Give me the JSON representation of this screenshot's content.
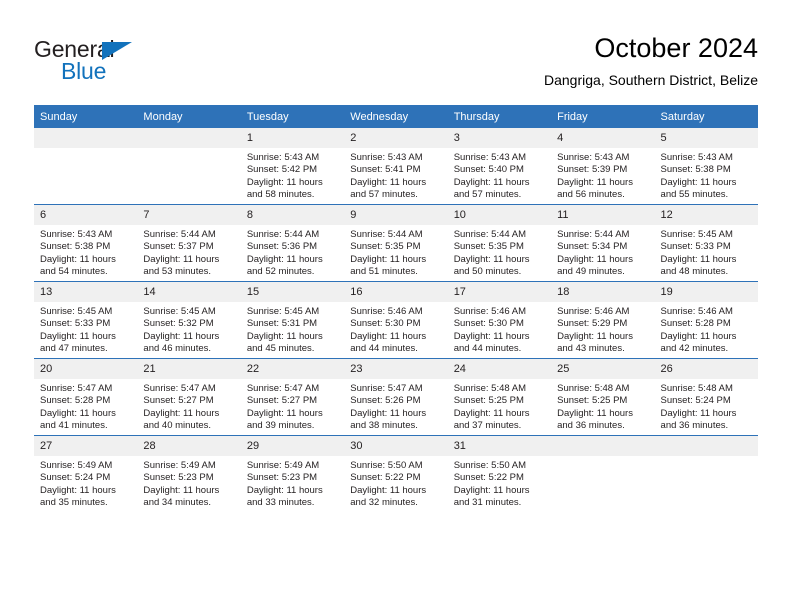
{
  "brand": {
    "name_part1": "General",
    "name_part2": "Blue",
    "accent_color": "#1272bc"
  },
  "header": {
    "title": "October 2024",
    "subtitle": "Dangriga, Southern District, Belize"
  },
  "theme": {
    "header_blue": "#2e72b8",
    "daynum_gray": "#f0f0f0"
  },
  "weekday_headers": [
    "Sunday",
    "Monday",
    "Tuesday",
    "Wednesday",
    "Thursday",
    "Friday",
    "Saturday"
  ],
  "labels": {
    "sunrise_prefix": "Sunrise:",
    "sunset_prefix": "Sunset:",
    "daylight_prefix": "Daylight:"
  },
  "weeks": [
    [
      {
        "day": "",
        "sunrise": "",
        "sunset": "",
        "daylight_line1": "",
        "daylight_line2": ""
      },
      {
        "day": "",
        "sunrise": "",
        "sunset": "",
        "daylight_line1": "",
        "daylight_line2": ""
      },
      {
        "day": "1",
        "sunrise": "Sunrise: 5:43 AM",
        "sunset": "Sunset: 5:42 PM",
        "daylight_line1": "Daylight: 11 hours",
        "daylight_line2": "and 58 minutes."
      },
      {
        "day": "2",
        "sunrise": "Sunrise: 5:43 AM",
        "sunset": "Sunset: 5:41 PM",
        "daylight_line1": "Daylight: 11 hours",
        "daylight_line2": "and 57 minutes."
      },
      {
        "day": "3",
        "sunrise": "Sunrise: 5:43 AM",
        "sunset": "Sunset: 5:40 PM",
        "daylight_line1": "Daylight: 11 hours",
        "daylight_line2": "and 57 minutes."
      },
      {
        "day": "4",
        "sunrise": "Sunrise: 5:43 AM",
        "sunset": "Sunset: 5:39 PM",
        "daylight_line1": "Daylight: 11 hours",
        "daylight_line2": "and 56 minutes."
      },
      {
        "day": "5",
        "sunrise": "Sunrise: 5:43 AM",
        "sunset": "Sunset: 5:38 PM",
        "daylight_line1": "Daylight: 11 hours",
        "daylight_line2": "and 55 minutes."
      }
    ],
    [
      {
        "day": "6",
        "sunrise": "Sunrise: 5:43 AM",
        "sunset": "Sunset: 5:38 PM",
        "daylight_line1": "Daylight: 11 hours",
        "daylight_line2": "and 54 minutes."
      },
      {
        "day": "7",
        "sunrise": "Sunrise: 5:44 AM",
        "sunset": "Sunset: 5:37 PM",
        "daylight_line1": "Daylight: 11 hours",
        "daylight_line2": "and 53 minutes."
      },
      {
        "day": "8",
        "sunrise": "Sunrise: 5:44 AM",
        "sunset": "Sunset: 5:36 PM",
        "daylight_line1": "Daylight: 11 hours",
        "daylight_line2": "and 52 minutes."
      },
      {
        "day": "9",
        "sunrise": "Sunrise: 5:44 AM",
        "sunset": "Sunset: 5:35 PM",
        "daylight_line1": "Daylight: 11 hours",
        "daylight_line2": "and 51 minutes."
      },
      {
        "day": "10",
        "sunrise": "Sunrise: 5:44 AM",
        "sunset": "Sunset: 5:35 PM",
        "daylight_line1": "Daylight: 11 hours",
        "daylight_line2": "and 50 minutes."
      },
      {
        "day": "11",
        "sunrise": "Sunrise: 5:44 AM",
        "sunset": "Sunset: 5:34 PM",
        "daylight_line1": "Daylight: 11 hours",
        "daylight_line2": "and 49 minutes."
      },
      {
        "day": "12",
        "sunrise": "Sunrise: 5:45 AM",
        "sunset": "Sunset: 5:33 PM",
        "daylight_line1": "Daylight: 11 hours",
        "daylight_line2": "and 48 minutes."
      }
    ],
    [
      {
        "day": "13",
        "sunrise": "Sunrise: 5:45 AM",
        "sunset": "Sunset: 5:33 PM",
        "daylight_line1": "Daylight: 11 hours",
        "daylight_line2": "and 47 minutes."
      },
      {
        "day": "14",
        "sunrise": "Sunrise: 5:45 AM",
        "sunset": "Sunset: 5:32 PM",
        "daylight_line1": "Daylight: 11 hours",
        "daylight_line2": "and 46 minutes."
      },
      {
        "day": "15",
        "sunrise": "Sunrise: 5:45 AM",
        "sunset": "Sunset: 5:31 PM",
        "daylight_line1": "Daylight: 11 hours",
        "daylight_line2": "and 45 minutes."
      },
      {
        "day": "16",
        "sunrise": "Sunrise: 5:46 AM",
        "sunset": "Sunset: 5:30 PM",
        "daylight_line1": "Daylight: 11 hours",
        "daylight_line2": "and 44 minutes."
      },
      {
        "day": "17",
        "sunrise": "Sunrise: 5:46 AM",
        "sunset": "Sunset: 5:30 PM",
        "daylight_line1": "Daylight: 11 hours",
        "daylight_line2": "and 44 minutes."
      },
      {
        "day": "18",
        "sunrise": "Sunrise: 5:46 AM",
        "sunset": "Sunset: 5:29 PM",
        "daylight_line1": "Daylight: 11 hours",
        "daylight_line2": "and 43 minutes."
      },
      {
        "day": "19",
        "sunrise": "Sunrise: 5:46 AM",
        "sunset": "Sunset: 5:28 PM",
        "daylight_line1": "Daylight: 11 hours",
        "daylight_line2": "and 42 minutes."
      }
    ],
    [
      {
        "day": "20",
        "sunrise": "Sunrise: 5:47 AM",
        "sunset": "Sunset: 5:28 PM",
        "daylight_line1": "Daylight: 11 hours",
        "daylight_line2": "and 41 minutes."
      },
      {
        "day": "21",
        "sunrise": "Sunrise: 5:47 AM",
        "sunset": "Sunset: 5:27 PM",
        "daylight_line1": "Daylight: 11 hours",
        "daylight_line2": "and 40 minutes."
      },
      {
        "day": "22",
        "sunrise": "Sunrise: 5:47 AM",
        "sunset": "Sunset: 5:27 PM",
        "daylight_line1": "Daylight: 11 hours",
        "daylight_line2": "and 39 minutes."
      },
      {
        "day": "23",
        "sunrise": "Sunrise: 5:47 AM",
        "sunset": "Sunset: 5:26 PM",
        "daylight_line1": "Daylight: 11 hours",
        "daylight_line2": "and 38 minutes."
      },
      {
        "day": "24",
        "sunrise": "Sunrise: 5:48 AM",
        "sunset": "Sunset: 5:25 PM",
        "daylight_line1": "Daylight: 11 hours",
        "daylight_line2": "and 37 minutes."
      },
      {
        "day": "25",
        "sunrise": "Sunrise: 5:48 AM",
        "sunset": "Sunset: 5:25 PM",
        "daylight_line1": "Daylight: 11 hours",
        "daylight_line2": "and 36 minutes."
      },
      {
        "day": "26",
        "sunrise": "Sunrise: 5:48 AM",
        "sunset": "Sunset: 5:24 PM",
        "daylight_line1": "Daylight: 11 hours",
        "daylight_line2": "and 36 minutes."
      }
    ],
    [
      {
        "day": "27",
        "sunrise": "Sunrise: 5:49 AM",
        "sunset": "Sunset: 5:24 PM",
        "daylight_line1": "Daylight: 11 hours",
        "daylight_line2": "and 35 minutes."
      },
      {
        "day": "28",
        "sunrise": "Sunrise: 5:49 AM",
        "sunset": "Sunset: 5:23 PM",
        "daylight_line1": "Daylight: 11 hours",
        "daylight_line2": "and 34 minutes."
      },
      {
        "day": "29",
        "sunrise": "Sunrise: 5:49 AM",
        "sunset": "Sunset: 5:23 PM",
        "daylight_line1": "Daylight: 11 hours",
        "daylight_line2": "and 33 minutes."
      },
      {
        "day": "30",
        "sunrise": "Sunrise: 5:50 AM",
        "sunset": "Sunset: 5:22 PM",
        "daylight_line1": "Daylight: 11 hours",
        "daylight_line2": "and 32 minutes."
      },
      {
        "day": "31",
        "sunrise": "Sunrise: 5:50 AM",
        "sunset": "Sunset: 5:22 PM",
        "daylight_line1": "Daylight: 11 hours",
        "daylight_line2": "and 31 minutes."
      },
      {
        "day": "",
        "sunrise": "",
        "sunset": "",
        "daylight_line1": "",
        "daylight_line2": ""
      },
      {
        "day": "",
        "sunrise": "",
        "sunset": "",
        "daylight_line1": "",
        "daylight_line2": ""
      }
    ]
  ]
}
